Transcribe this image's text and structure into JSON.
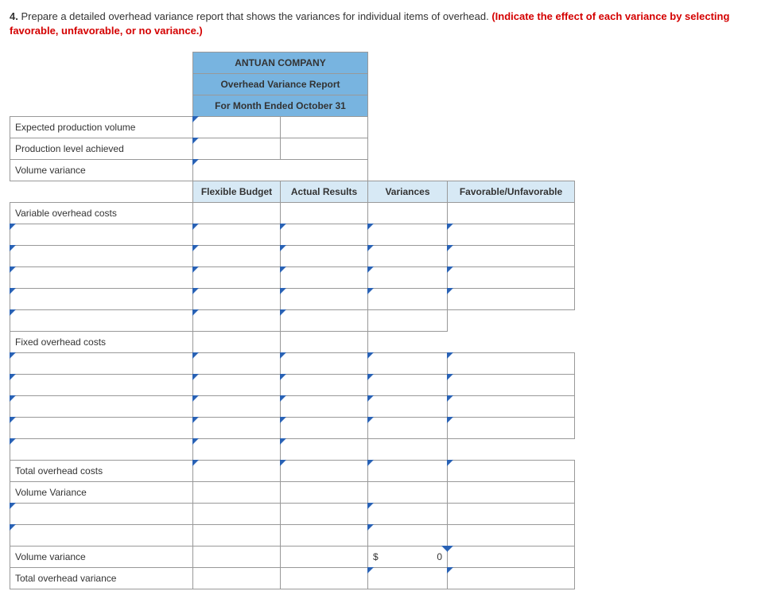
{
  "instruction": {
    "num": "4.",
    "text": "Prepare a detailed overhead variance report that shows the variances for individual items of overhead. ",
    "red": "(Indicate the effect of each variance by selecting favorable, unfavorable, or no variance.)"
  },
  "header": {
    "company": "ANTUAN COMPANY",
    "report_title": "Overhead Variance Report",
    "period": "For Month Ended October 31"
  },
  "top_rows": [
    "Expected production volume",
    "Production level achieved",
    "Volume variance"
  ],
  "cols": {
    "flex": "Flexible Budget",
    "actual": "Actual Results",
    "var": "Variances",
    "fu": "Favorable/Unfavorable"
  },
  "sections": {
    "variable_label": "Variable overhead costs",
    "fixed_label": "Fixed overhead costs",
    "total_oh_label": "Total overhead costs",
    "vol_var_label": "Volume Variance",
    "vol_var_lower": "Volume variance",
    "total_var_label": "Total overhead variance"
  },
  "values": {
    "vol_var_currency": "$",
    "vol_var_amount": "0"
  }
}
